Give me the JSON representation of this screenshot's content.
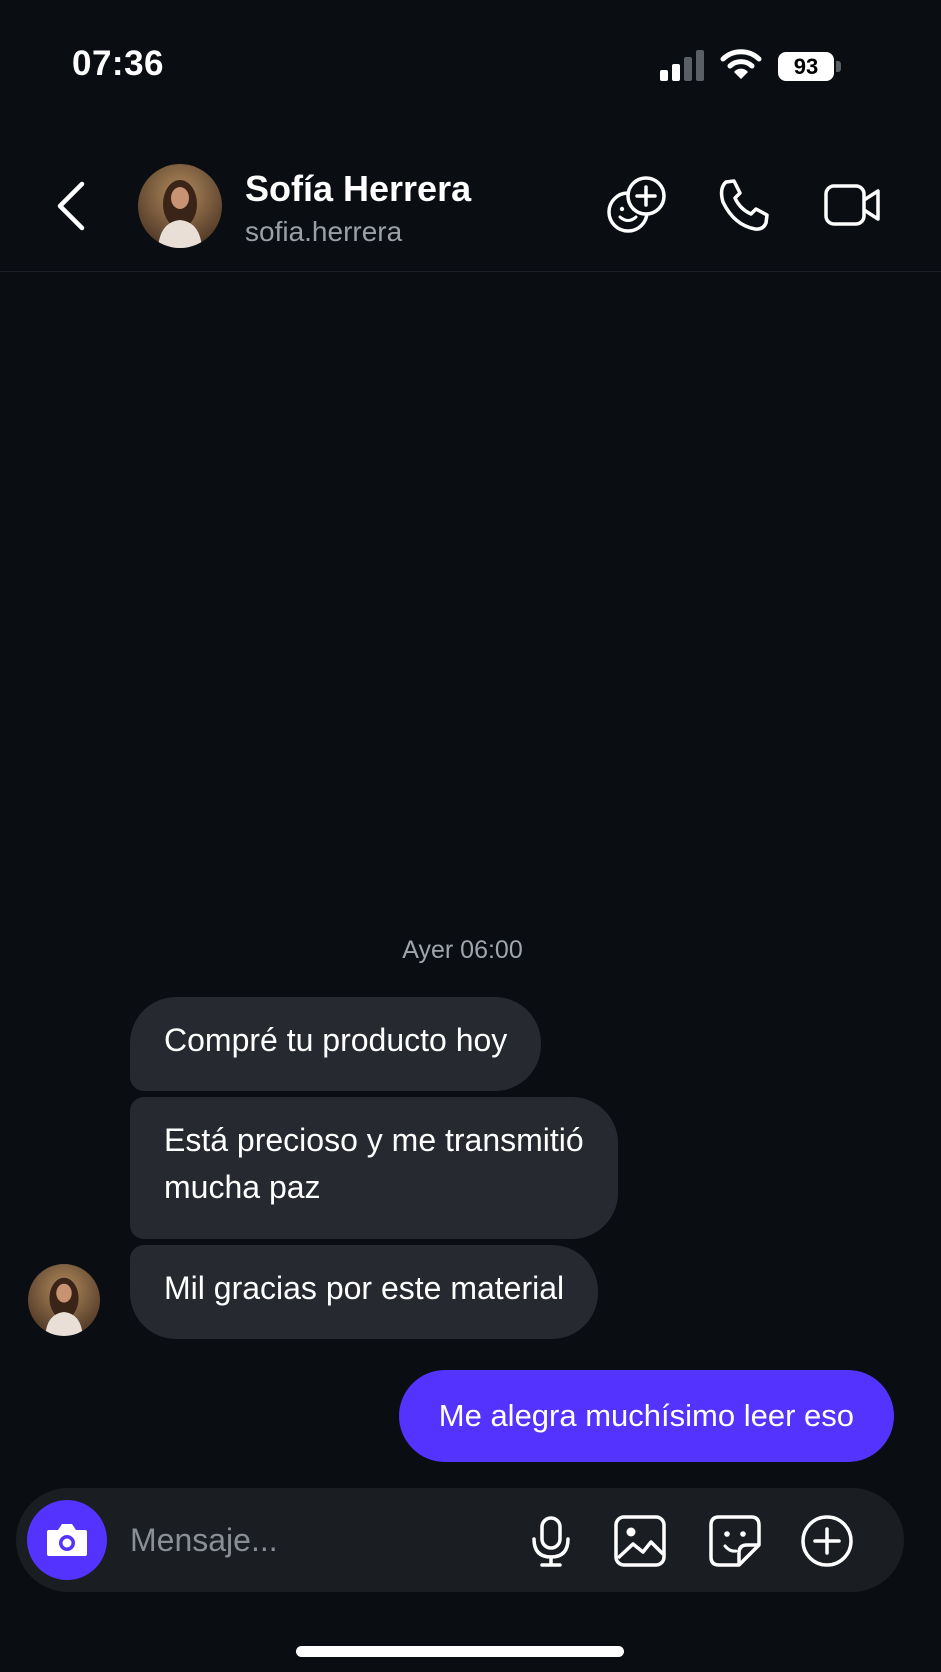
{
  "status_bar": {
    "time": "07:36",
    "battery": "93",
    "icons": [
      "signal-icon",
      "wifi-icon",
      "battery-icon"
    ]
  },
  "header": {
    "name": "Sofía Herrera",
    "username": "sofia.herrera",
    "icons": [
      "back-icon",
      "add-people-icon",
      "phone-icon",
      "video-camera-icon"
    ]
  },
  "conversation": {
    "timestamp": "Ayer 06:00",
    "received": [
      "Compré tu producto hoy",
      "Está precioso y me transmitió mucha paz",
      "Mil gracias por este material"
    ],
    "sent": [
      "Me alegra muchísimo leer eso"
    ]
  },
  "composer": {
    "placeholder": "Mensaje...",
    "icons": [
      "camera-icon",
      "microphone-icon",
      "gallery-icon",
      "sticker-icon",
      "plus-icon"
    ]
  },
  "colors": {
    "background": "#0a0d12",
    "received_bubble": "#26292f",
    "accent": "#5533ff",
    "secondary_text": "#9aa0a8"
  }
}
